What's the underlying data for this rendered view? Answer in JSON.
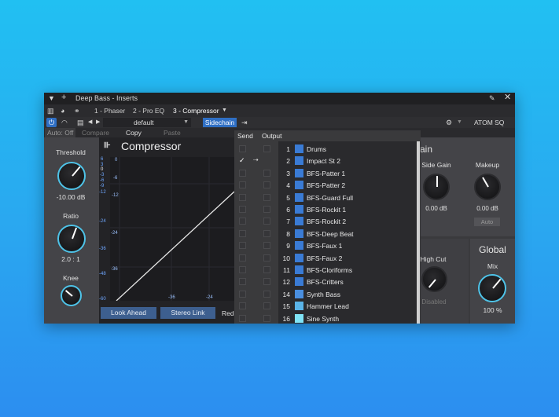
{
  "window": {
    "title": "Deep Bass - Inserts",
    "pin_icon": "pin-icon",
    "close_icon": "close-icon"
  },
  "tabs": [
    {
      "label": "1 - Phaser"
    },
    {
      "label": "2 - Pro EQ"
    },
    {
      "label": "3 - Compressor"
    }
  ],
  "toolbar": {
    "preset": "default",
    "sidechain": "Sidechain",
    "device": "ATOM SQ"
  },
  "subbar": {
    "auto": "Auto: Off",
    "compare": "Compare",
    "copy": "Copy",
    "paste": "Paste"
  },
  "plugin": {
    "name": "Compressor",
    "threshold_label": "Threshold",
    "threshold_value": "-10.00 dB",
    "ratio_label": "Ratio",
    "ratio_value": "2.0 : 1",
    "knee_label": "Knee",
    "look_ahead": "Look Ahead",
    "stereo_link": "Stereo Link",
    "reduction_partial": "Red",
    "meter_labels": [
      "6",
      "3",
      "0",
      "-3",
      "-6",
      "-9",
      "-12",
      "-24",
      "-36",
      "-48",
      "-60"
    ],
    "graph_y_labels": [
      "0",
      "-6",
      "-12",
      "-24",
      "-36"
    ],
    "graph_x_labels": [
      "-36",
      "-24"
    ]
  },
  "right_panel": {
    "section_partial": "ain",
    "side_gain_label": "Side Gain",
    "side_gain_value": "0.00 dB",
    "makeup_label": "Makeup",
    "makeup_value": "0.00 dB",
    "auto_button": "Auto",
    "high_cut_label": "High Cut",
    "high_cut_value": "Disabled",
    "global_title": "Global",
    "mix_label": "Mix",
    "mix_value": "100 %"
  },
  "sidechain_menu": {
    "send_header": "Send",
    "output_header": "Output",
    "items": [
      {
        "num": "1",
        "name": "Drums",
        "color": "#3a7bd5",
        "checked": false
      },
      {
        "num": "2",
        "name": "Impact St 2",
        "color": "#3a7bd5",
        "checked": true
      },
      {
        "num": "3",
        "name": "BFS-Patter 1",
        "color": "#3a7bd5",
        "checked": false
      },
      {
        "num": "4",
        "name": "BFS-Patter 2",
        "color": "#3a7bd5",
        "checked": false
      },
      {
        "num": "5",
        "name": "BFS-Guard Full",
        "color": "#3a7bd5",
        "checked": false
      },
      {
        "num": "6",
        "name": "BFS-Rockit 1",
        "color": "#3a7bd5",
        "checked": false
      },
      {
        "num": "7",
        "name": "BFS-Rockit 2",
        "color": "#3a7bd5",
        "checked": false
      },
      {
        "num": "8",
        "name": "BFS-Deep Beat",
        "color": "#3a7bd5",
        "checked": false
      },
      {
        "num": "9",
        "name": "BFS-Faux 1",
        "color": "#3a7bd5",
        "checked": false
      },
      {
        "num": "10",
        "name": "BFS-Faux 2",
        "color": "#3a7bd5",
        "checked": false
      },
      {
        "num": "11",
        "name": "BFS-Cloriforms",
        "color": "#3a7bd5",
        "checked": false
      },
      {
        "num": "12",
        "name": "BFS-Critters",
        "color": "#3a7bd5",
        "checked": false
      },
      {
        "num": "14",
        "name": "Synth Bass",
        "color": "#4a8fe0",
        "checked": false
      },
      {
        "num": "15",
        "name": "Hammer Lead",
        "color": "#5ab4e8",
        "checked": false
      },
      {
        "num": "16",
        "name": "Sine Synth",
        "color": "#7fe3f5",
        "checked": false
      }
    ]
  },
  "colors": {
    "accent": "#4ec3e8",
    "button_blue": "#3d5f8f",
    "sidechain_blue": "#2f6fc4"
  }
}
